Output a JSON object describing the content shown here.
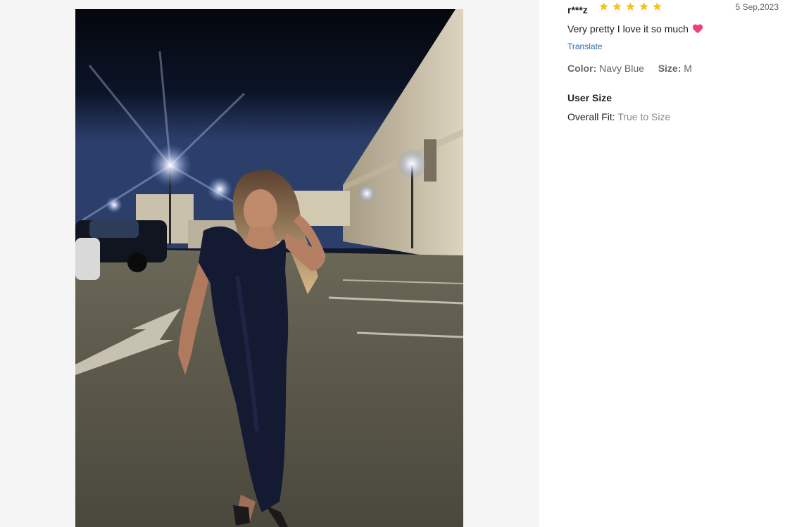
{
  "review": {
    "username": "r***z",
    "rating": 5,
    "rating_max": 5,
    "date": "5 Sep,2023",
    "text": "Very pretty I love it so much",
    "translate_label": "Translate",
    "color_label": "Color:",
    "color_value": "Navy Blue",
    "size_label": "Size:",
    "size_value": "M",
    "user_size_title": "User Size",
    "overall_fit_label": "Overall Fit:",
    "overall_fit_value": "True to Size"
  },
  "icons": {
    "star": "star-icon",
    "heart": "heart-icon"
  },
  "colors": {
    "star": "#f7c21a",
    "heart": "#ef3f7a",
    "link": "#2d68a8",
    "dress": "#151a33"
  }
}
